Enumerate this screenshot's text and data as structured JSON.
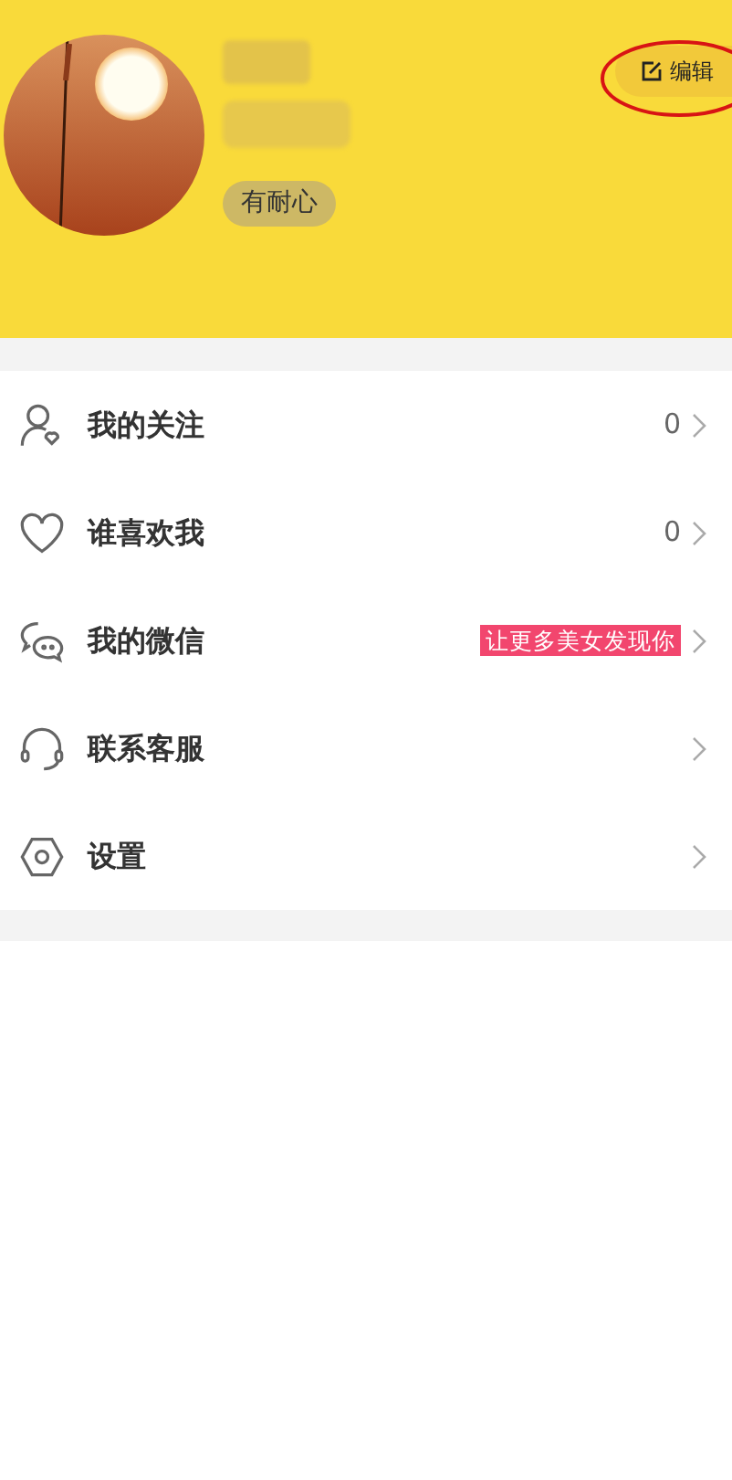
{
  "profile": {
    "tag": "有耐心",
    "edit_button": "编辑"
  },
  "menu": [
    {
      "kind": "follow",
      "label": "我的关注",
      "count": "0"
    },
    {
      "kind": "likes",
      "label": "谁喜欢我",
      "count": "0"
    },
    {
      "kind": "wechat",
      "label": "我的微信",
      "promo": "让更多美女发现你"
    },
    {
      "kind": "service",
      "label": "联系客服"
    },
    {
      "kind": "settings",
      "label": "设置"
    }
  ]
}
